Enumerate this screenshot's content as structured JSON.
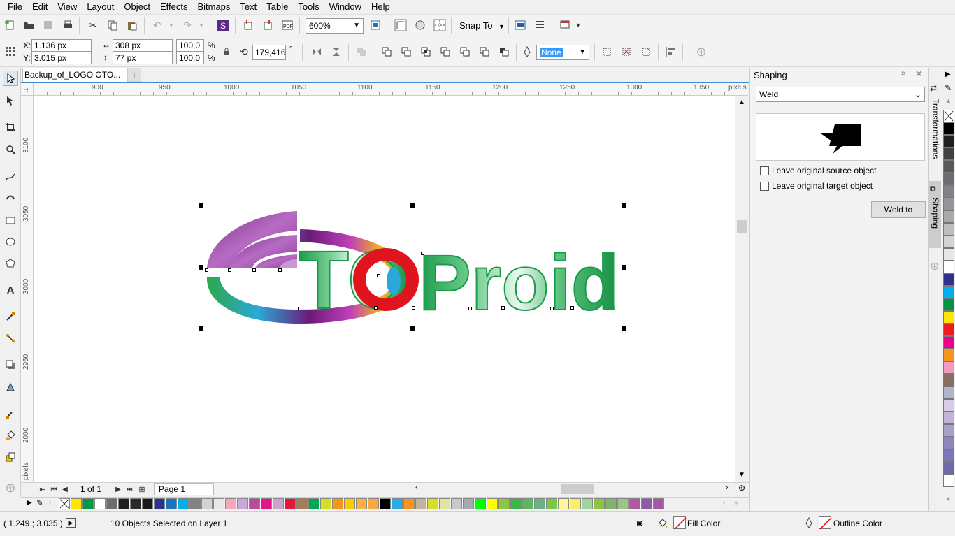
{
  "menu": {
    "items": [
      "File",
      "Edit",
      "View",
      "Layout",
      "Object",
      "Effects",
      "Bitmaps",
      "Text",
      "Table",
      "Tools",
      "Window",
      "Help"
    ]
  },
  "toolbar": {
    "zoom_value": "600%",
    "snap_label": "Snap To"
  },
  "property_bar": {
    "x_label": "X:",
    "x_value": "1.136 px",
    "y_label": "Y:",
    "y_value": "3.015 px",
    "width_value": "308 px",
    "height_value": "77 px",
    "scale_w": "100,0",
    "scale_h": "100,0",
    "percent_sign": "%",
    "rotation": "179,416",
    "degree_sign": "°",
    "outline_width": "None"
  },
  "document": {
    "tab_title": "Backup_of_LOGO OTO..."
  },
  "ruler": {
    "h_labels": [
      "900",
      "950",
      "1000",
      "1050",
      "1100",
      "1150",
      "1200",
      "1250",
      "1300",
      "1350"
    ],
    "h_unit": "pixels",
    "v_labels": [
      "3100",
      "3050",
      "3000",
      "2950",
      "2000"
    ],
    "v_unit": "pixels"
  },
  "logo": {
    "text_to": "TO",
    "text_proid": "Proid",
    "green": "#1fa24d",
    "red": "#e0141e",
    "purple": "#8e3a96"
  },
  "pager": {
    "page_counter": "1 of 1",
    "page_tab": "Page 1"
  },
  "status": {
    "coords": "( 1.249 ; 3.035 )",
    "selection": "10 Objects Selected on Layer 1",
    "fill_label": "Fill Color",
    "outline_label": "Outline Color"
  },
  "shaping_panel": {
    "title": "Shaping",
    "mode": "Weld",
    "leave_source": "Leave original source object",
    "leave_target": "Leave original target object",
    "weld_button": "Weld to"
  },
  "side_tabs": {
    "transformations": "Transformations",
    "shaping": "Shaping"
  },
  "palette_colors": [
    "#ffffff",
    "#ffe600",
    "#009a44",
    "#ffffff",
    "#6e6e6e",
    "#231f20",
    "#2b2a29",
    "#1a1a1a",
    "#2e3192",
    "#1b75bc",
    "#00aeef",
    "#808285",
    "#d1d3d4",
    "#e6e7e8",
    "#f7a8b8",
    "#c8a8d8",
    "#ba4a9c",
    "#e2168a",
    "#c9a6c9",
    "#e31837",
    "#a67c52",
    "#00a651",
    "#d7df23",
    "#f7941d",
    "#ffcb05",
    "#fbb040",
    "#f9a742",
    "#000000",
    "#29abe2",
    "#f7941d",
    "#c2b59b",
    "#d7df23",
    "#e3e1a3",
    "#c7c8ca",
    "#a7a9ac",
    "#00ff00",
    "#ffff00",
    "#8dc63f",
    "#39b54a",
    "#5cb85c",
    "#6ab187",
    "#7ac943",
    "#fff799",
    "#f9ed69",
    "#a3d39c",
    "#8cc63f",
    "#7fb56b",
    "#9cc487",
    "#b1589f",
    "#8b5ca5",
    "#a05aa5"
  ],
  "right_palette_colors": [
    "#ffffff",
    "#000000",
    "#231f20",
    "#414042",
    "#58595b",
    "#6d6e71",
    "#808285",
    "#939598",
    "#a7a9ac",
    "#bcbec0",
    "#d1d3d4",
    "#e6e7e8",
    "#ffffff",
    "#2e3192",
    "#00aeef",
    "#009444",
    "#ffe600",
    "#ed1c24",
    "#ec008c",
    "#f7941d",
    "#f49ac1",
    "#8c6e5f",
    "#b3b3cc",
    "#d5cde5",
    "#c4b3d8",
    "#a6a0cc",
    "#8c87bf",
    "#7c77b9",
    "#6d6aa8",
    "#ffffff"
  ]
}
